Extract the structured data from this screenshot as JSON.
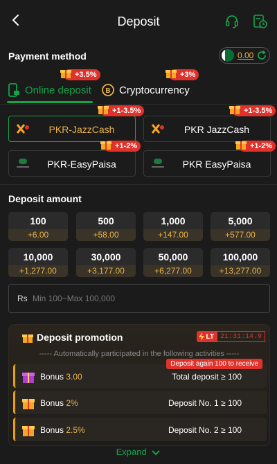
{
  "header": {
    "title": "Deposit"
  },
  "payment": {
    "section_title": "Payment method",
    "balance": "0.00"
  },
  "tabs": [
    {
      "label": "Online deposit",
      "bonus": "+3.5%"
    },
    {
      "label": "Cryptocurrency",
      "bonus": "+3%"
    }
  ],
  "methods": [
    {
      "label": "PKR-JazzCash",
      "bonus": "+1-3.5%"
    },
    {
      "label": "PKR JazzCash",
      "bonus": "+1-3.5%"
    },
    {
      "label": "PKR-EasyPaisa",
      "bonus": "+1-2%"
    },
    {
      "label": "PKR EasyPaisa",
      "bonus": "+1-2%"
    }
  ],
  "amount": {
    "section_title": "Deposit amount",
    "options": [
      {
        "value": "100",
        "bonus": "+6.00"
      },
      {
        "value": "500",
        "bonus": "+58.00"
      },
      {
        "value": "1,000",
        "bonus": "+147.00"
      },
      {
        "value": "5,000",
        "bonus": "+577.00"
      },
      {
        "value": "10,000",
        "bonus": "+1,277.00"
      },
      {
        "value": "30,000",
        "bonus": "+3,177.00"
      },
      {
        "value": "50,000",
        "bonus": "+6,277.00"
      },
      {
        "value": "100,000",
        "bonus": "+13,277.00"
      }
    ],
    "currency": "Rs",
    "placeholder": "Min 100~Max 100,000"
  },
  "promo": {
    "title": "Deposit promotion",
    "timer_tag": "LT",
    "timer": "21:31:14.9",
    "subtitle": "----- Automatically participated in the following activities -----",
    "tip": "Deposit again 100 to receive",
    "rows": [
      {
        "label": "Bonus",
        "value": "3.00",
        "condition": "Total deposit ≥ 100"
      },
      {
        "label": "Bonus",
        "value": "2%",
        "condition": "Deposit No. 1 ≥ 100"
      },
      {
        "label": "Bonus",
        "value": "2.5%",
        "condition": "Deposit No. 2 ≥ 100"
      }
    ],
    "expand_label": "Expand"
  },
  "colors": {
    "accent": "#16a34a",
    "gold": "#e8b34a",
    "red": "#e0322b"
  }
}
